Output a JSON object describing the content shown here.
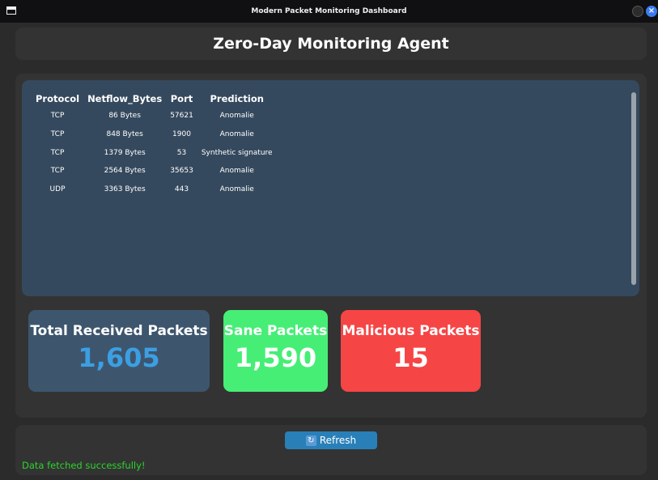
{
  "window": {
    "title": "Modern Packet Monitoring Dashboard"
  },
  "header": {
    "title": "Zero-Day Monitoring Agent"
  },
  "table": {
    "columns": [
      "Protocol",
      "Netflow_Bytes",
      "Port",
      "Prediction"
    ],
    "rows": [
      [
        "TCP",
        "86 Bytes",
        "57621",
        "Anomalie"
      ],
      [
        "TCP",
        "848 Bytes",
        "1900",
        "Anomalie"
      ],
      [
        "TCP",
        "1379 Bytes",
        "53",
        "Synthetic signature"
      ],
      [
        "TCP",
        "2564 Bytes",
        "35653",
        "Anomalie"
      ],
      [
        "UDP",
        "3363 Bytes",
        "443",
        "Anomalie"
      ]
    ]
  },
  "stats": {
    "total": {
      "label": "Total Received Packets",
      "value": "1,605"
    },
    "sane": {
      "label": "Sane Packets",
      "value": "1,590"
    },
    "malicious": {
      "label": "Malicious Packets",
      "value": "15"
    }
  },
  "footer": {
    "refresh_label": "Refresh",
    "refresh_icon": "refresh-icon",
    "status": "Data fetched successfully!"
  },
  "colors": {
    "accent_blue": "#2980b9",
    "sane_green": "#46ee76",
    "malicious_red": "#f64545",
    "status_green": "#2bd62b"
  }
}
